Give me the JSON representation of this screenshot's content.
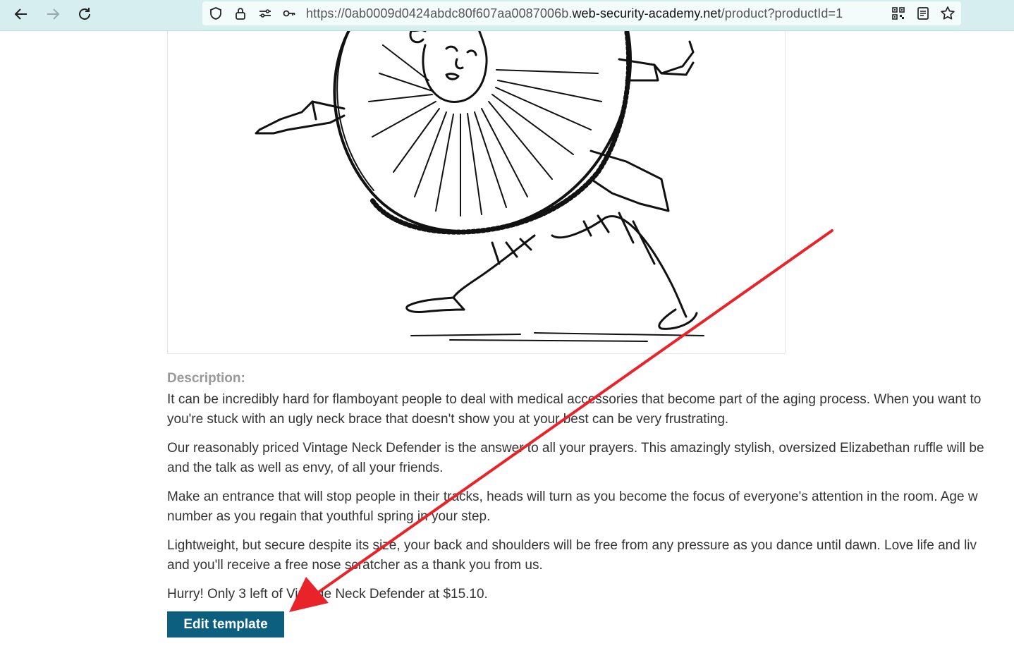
{
  "browser": {
    "url_prefix": "https://0ab0009d0424abdc80f607aa0087006b.",
    "url_host": "web-security-academy.net",
    "url_path": "/product?productId=1",
    "icons": [
      "back-icon",
      "forward-icon",
      "reload-icon",
      "shield-icon",
      "lock-icon",
      "permissions-icon",
      "key-icon",
      "qr-code-icon",
      "reader-view-icon",
      "bookmark-star-icon"
    ]
  },
  "product": {
    "description_label": "Description:",
    "paragraphs": [
      "It can be incredibly hard for flamboyant people to deal with medical accessories that become part of the aging process. When you want to",
      "you're stuck with an ugly neck brace that doesn't show you at your best can be very frustrating.",
      "Our reasonably priced Vintage Neck Defender is the answer to all your prayers. This amazingly stylish, oversized Elizabethan ruffle will be",
      "and the talk as well as envy, of all your friends.",
      "Make an entrance that will stop people in their tracks, heads will turn as you become the focus of everyone's attention in the room. Age w",
      "number as you regain that youthful spring in your step.",
      "Lightweight, but secure despite its size, your back and shoulders will be free from any pressure as you dance until dawn. Love life and liv",
      "and you'll receive a free nose scratcher as a thank you from us."
    ],
    "stock_text": "Hurry! Only 3 left of Vintage Neck Defender at $15.10.",
    "edit_button_label": "Edit template"
  },
  "annotation": {
    "arrow_color": "#e8232a"
  }
}
